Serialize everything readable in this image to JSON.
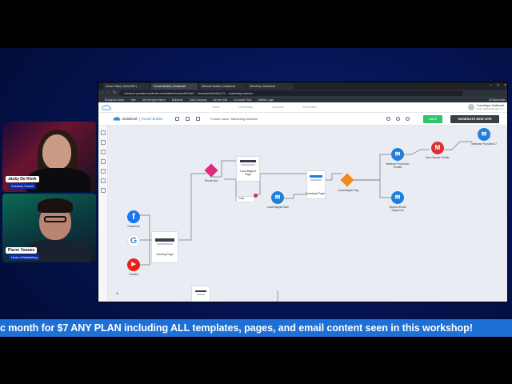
{
  "participants": [
    {
      "name": "Jacky De Klerk",
      "role": "Success Coach"
    },
    {
      "name": "Pierre Younes",
      "role": "Head of Marketing"
    }
  ],
  "browser": {
    "tabs": [
      "Home Office | BUILDER | ...",
      "Funnel Builder | Builderall",
      "Website Builder | Builderall",
      "Workflow | Builderall"
    ],
    "active_tab": 1,
    "url": "checkout.yoursite.builderall.com/builder/funnel/c4f1b3a9 ... /funnels/edit/fe9a1c72 ... marketing-machine",
    "bookmarks": [
      "Bluegrass Notes",
      "Hide",
      "My Net Agent Items",
      "Builderall",
      "Total Company",
      "My new Site",
      "Economic Tiles",
      "Affiliate Login"
    ],
    "all_bookmarks": "All Bookmarks"
  },
  "site_header": {
    "nav": [
      "Tools",
      "University",
      "Connect",
      "Favorites"
    ],
    "user_name": "Travelingsu Builderall",
    "user_email": "builderall@builderall.com"
  },
  "app_bar": {
    "brand": "Builderall",
    "product": "Funnel Builder",
    "funnel_name": "Funnel name: Marketing Machine",
    "save_label": "SAVE",
    "generate_label": "GENERATE NEW SITE"
  },
  "nodes": {
    "facebook": "Facebook",
    "google": "Google",
    "youtube": "Youtube",
    "landing": "Landing Page",
    "phone": "Phone Bot",
    "leadmagnet": "Lead Magnet Page",
    "goal": "Goal",
    "leadmagnet_mail": "Lead Magnet Mail",
    "download": "Download Page",
    "leadmagnet_tag": "Lead Magnet Tag",
    "webinar_email": "Webinar Promotion Emails",
    "nurture_email": "Nurture Email Sequence",
    "non_opener": "Non Opener Emails",
    "webinar_promo": "Webinar Promotion 2"
  },
  "banner_text": "c month for $7 ANY PLAN including ALL templates, pages, and email content seen in this workshop!",
  "colors": {
    "banner": "#1e6fd6",
    "save": "#30c36a",
    "email_node": "#1f7fd9",
    "tag_node": "#f28a1d",
    "phone_node": "#e0297a",
    "gmail_node": "#d93232"
  }
}
